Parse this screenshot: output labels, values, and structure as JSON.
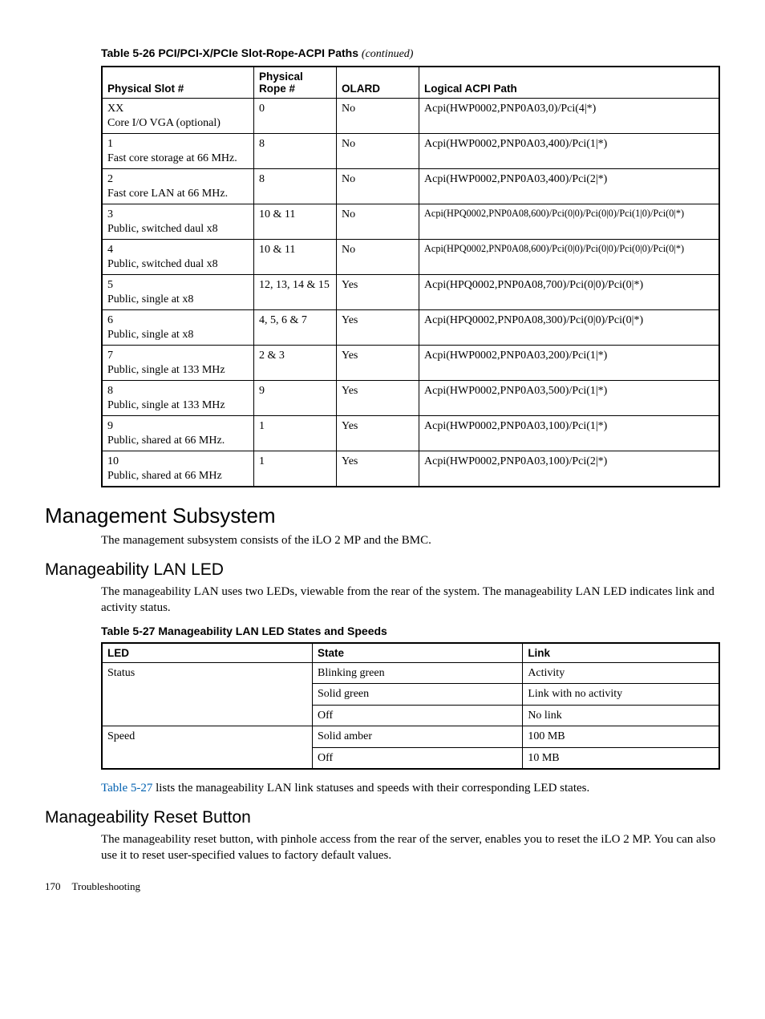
{
  "table26": {
    "caption_prefix": "Table  5-26  PCI/PCI-X/PCIe Slot-Rope-ACPI Paths",
    "caption_suffix": "(continued)",
    "headers": [
      "Physical Slot #",
      "Physical Rope #",
      "OLARD",
      "Logical ACPI Path"
    ],
    "rows": [
      {
        "slot_a": "XX",
        "slot_b": "Core I/O VGA (optional)",
        "rope": "0",
        "olard": "No",
        "path": "Acpi(HWP0002,PNP0A03,0)/Pci(4|*)"
      },
      {
        "slot_a": "1",
        "slot_b": "Fast core storage at 66 MHz.",
        "rope": "8",
        "olard": "No",
        "path": "Acpi(HWP0002,PNP0A03,400)/Pci(1|*)"
      },
      {
        "slot_a": "2",
        "slot_b": "Fast core LAN at 66 MHz.",
        "rope": "8",
        "olard": "No",
        "path": "Acpi(HWP0002,PNP0A03,400)/Pci(2|*)"
      },
      {
        "slot_a": "3",
        "slot_b": "Public, switched daul x8",
        "rope": "10 & 11",
        "olard": "No",
        "path": "Acpi(HPQ0002,PNP0A08,600)/Pci(0|0)/Pci(0|0)/Pci(1|0)/Pci(0|*)",
        "small": true
      },
      {
        "slot_a": "4",
        "slot_b": "Public, switched dual x8",
        "rope": "10 & 11",
        "olard": "No",
        "path": "Acpi(HPQ0002,PNP0A08,600)/Pci(0|0)/Pci(0|0)/Pci(0|0)/Pci(0|*)",
        "small": true
      },
      {
        "slot_a": "5",
        "slot_b": "Public, single at x8",
        "rope": "12, 13, 14 & 15",
        "olard": "Yes",
        "path": "Acpi(HPQ0002,PNP0A08,700)/Pci(0|0)/Pci(0|*)"
      },
      {
        "slot_a": "6",
        "slot_b": "Public, single at x8",
        "rope": "4, 5, 6 & 7",
        "olard": "Yes",
        "path": "Acpi(HPQ0002,PNP0A08,300)/Pci(0|0)/Pci(0|*)"
      },
      {
        "slot_a": "7",
        "slot_b": "Public, single at 133 MHz",
        "rope": "2 & 3",
        "olard": "Yes",
        "path": "Acpi(HWP0002,PNP0A03,200)/Pci(1|*)"
      },
      {
        "slot_a": "8",
        "slot_b": "Public, single at 133 MHz",
        "rope": "9",
        "olard": "Yes",
        "path": "Acpi(HWP0002,PNP0A03,500)/Pci(1|*)"
      },
      {
        "slot_a": "9",
        "slot_b": "Public, shared at 66 MHz.",
        "rope": "1",
        "olard": "Yes",
        "path": "Acpi(HWP0002,PNP0A03,100)/Pci(1|*)"
      },
      {
        "slot_a": "10",
        "slot_b": "Public, shared at 66 MHz",
        "rope": "1",
        "olard": "Yes",
        "path": "Acpi(HWP0002,PNP0A03,100)/Pci(2|*)"
      }
    ]
  },
  "headings": {
    "h2_management": "Management Subsystem",
    "h3_lanled": "Manageability LAN LED",
    "h3_reset": "Manageability Reset Button"
  },
  "paras": {
    "mgmt_intro": "The management subsystem consists of the iLO 2 MP and the BMC.",
    "lanled_intro": "The manageability LAN uses two LEDs, viewable from the rear of the system. The manageability LAN LED indicates link and activity status.",
    "linkref_label": "Table 5-27",
    "lanled_after": " lists the manageability LAN link statuses and speeds with their corresponding LED states.",
    "reset_body": "The manageability reset button, with pinhole access from the rear of the server, enables you to reset the iLO 2 MP. You can also use it to reset user-specified values to factory default values."
  },
  "table27": {
    "caption": "Table  5-27  Manageability LAN LED States and Speeds",
    "headers": [
      "LED",
      "State",
      "Link"
    ],
    "groups": [
      {
        "led": "Status",
        "rows": [
          {
            "state": "Blinking green",
            "link": "Activity"
          },
          {
            "state": "Solid green",
            "link": "Link with no activity"
          },
          {
            "state": "Off",
            "link": "No link"
          }
        ]
      },
      {
        "led": "Speed",
        "rows": [
          {
            "state": "Solid amber",
            "link": "100 MB"
          },
          {
            "state": "Off",
            "link": "10 MB"
          }
        ]
      }
    ]
  },
  "footer": {
    "pageno": "170",
    "section": "Troubleshooting"
  }
}
